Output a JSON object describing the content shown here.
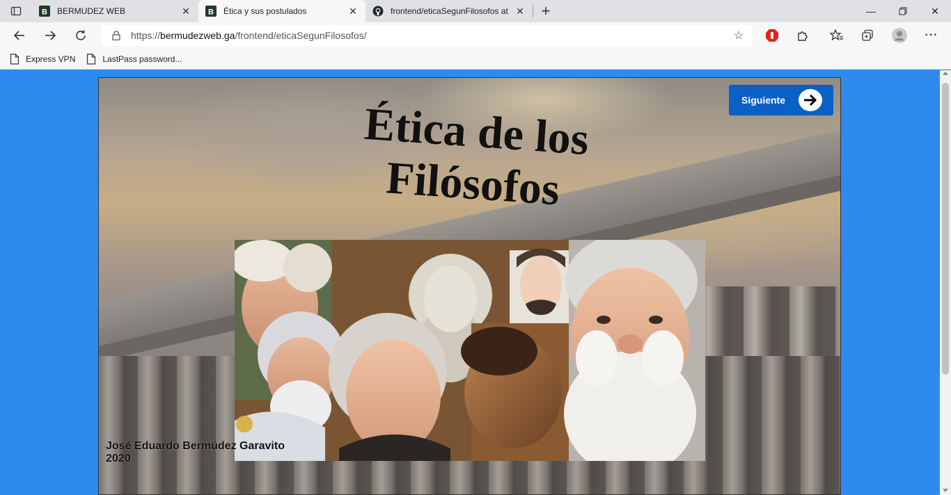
{
  "browser": {
    "tabs": [
      {
        "title": "BERMUDEZ WEB",
        "favicon": "bermudez-b-icon",
        "active": false
      },
      {
        "title": "Ética y sus postulados",
        "favicon": "bermudez-b-icon",
        "active": true
      },
      {
        "title": "frontend/eticaSegunFilosofos at",
        "favicon": "github-icon",
        "active": false
      }
    ],
    "url_prefix": "https://",
    "url_domain": "bermudezweb.ga",
    "url_path": "/frontend/eticaSegunFilosofos/",
    "bookmarks": [
      {
        "label": "Express VPN"
      },
      {
        "label": "LastPass password..."
      }
    ]
  },
  "page": {
    "title_line1": "Ética de los",
    "title_line2": "Filósofos",
    "next_button": "Siguiente",
    "author_name": "José Eduardo Bermúdez Garavito",
    "author_year": "2020"
  },
  "colors": {
    "page_background": "#2f8af0",
    "button": "#0a60c4"
  }
}
